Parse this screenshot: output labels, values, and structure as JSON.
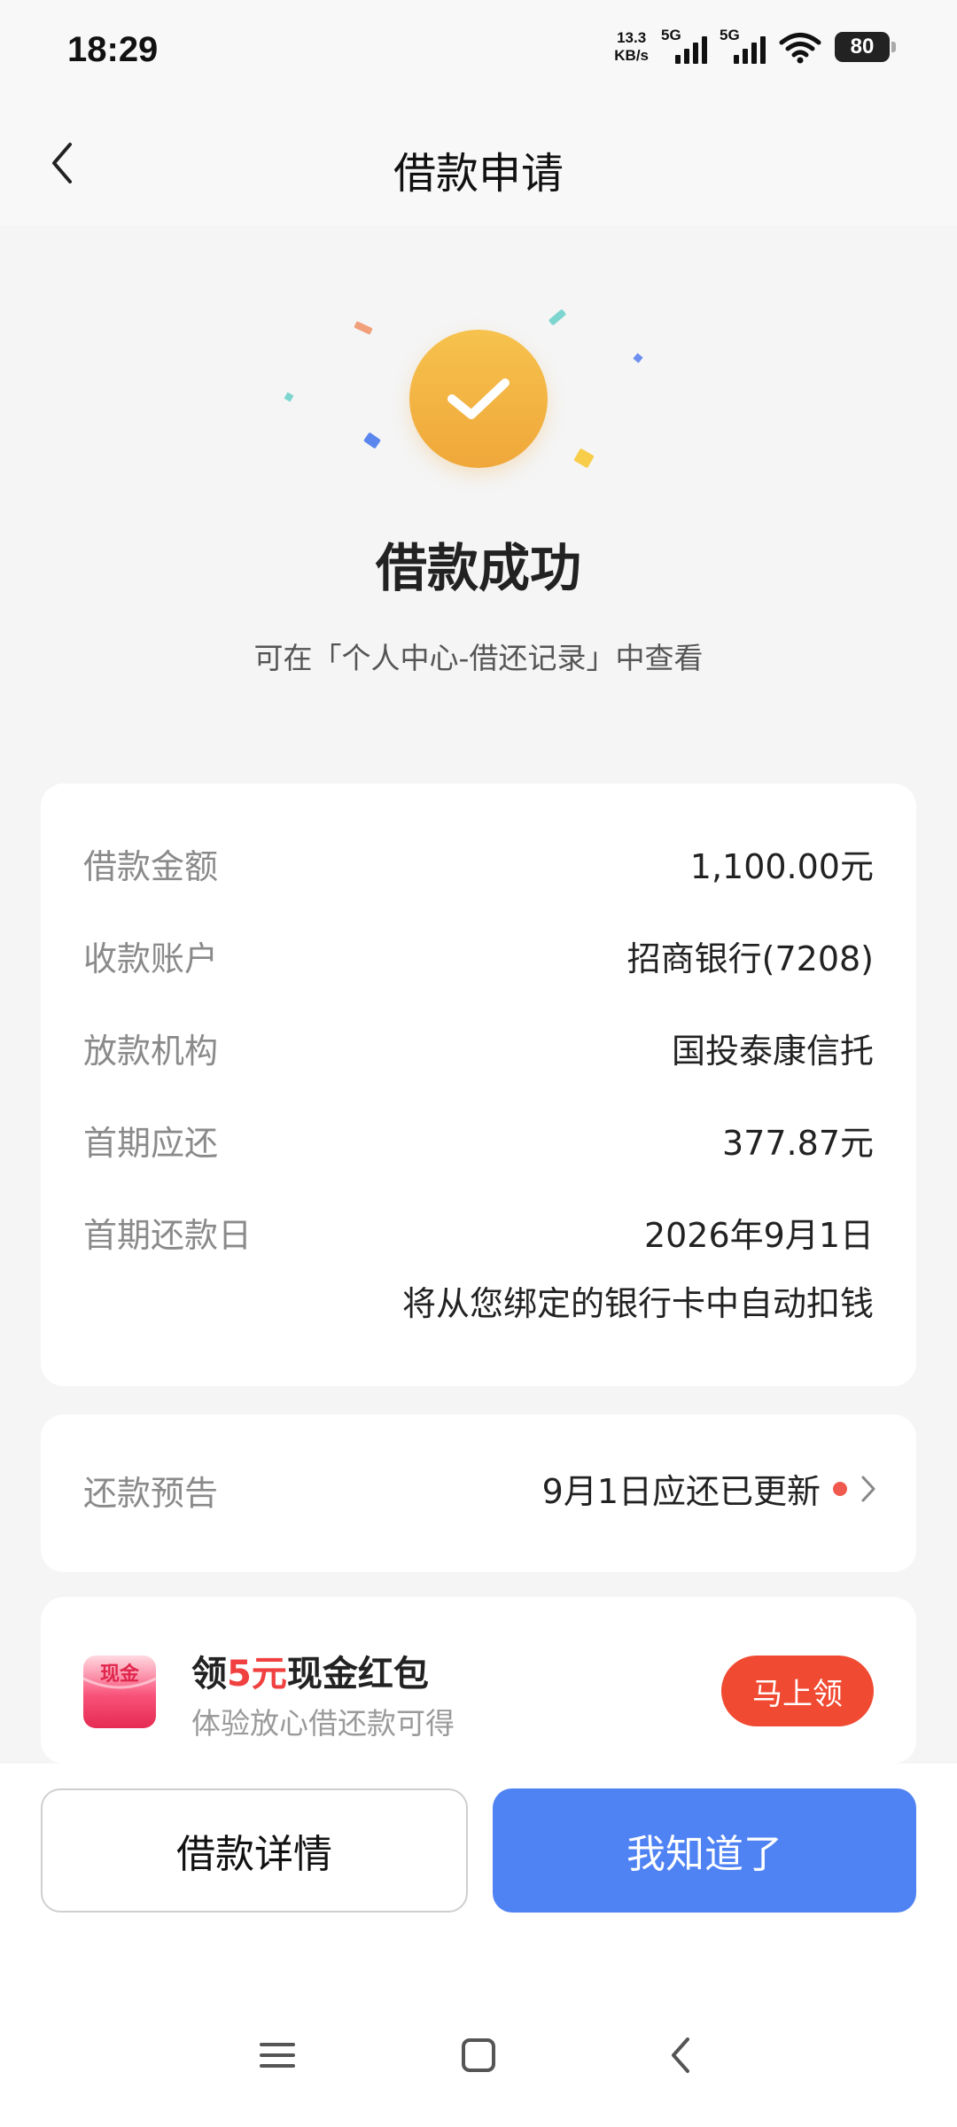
{
  "status_bar": {
    "time": "18:29",
    "net_speed_value": "13.3",
    "net_speed_unit": "KB/s",
    "signal_1_label": "5G",
    "signal_2_label": "5G",
    "battery": "80"
  },
  "header": {
    "title": "借款申请"
  },
  "hero": {
    "title": "借款成功",
    "subtitle": "可在「个人中心-借还记录」中查看"
  },
  "details": {
    "rows": [
      {
        "label": "借款金额",
        "value": "1,100.00元"
      },
      {
        "label": "收款账户",
        "value": "招商银行(7208)"
      },
      {
        "label": "放款机构",
        "value": "国投泰康信托"
      },
      {
        "label": "首期应还",
        "value": "377.87元"
      },
      {
        "label": "首期还款日",
        "value": "2026年9月1日"
      }
    ],
    "note": "将从您绑定的银行卡中自动扣钱"
  },
  "repayment_notice": {
    "label": "还款预告",
    "value": "9月1日应还已更新"
  },
  "promo": {
    "icon_text": "现金",
    "title_prefix": "领",
    "title_highlight": "5元",
    "title_suffix": "现金红包",
    "subtitle": "体验放心借还款可得",
    "button": "马上领"
  },
  "actions": {
    "detail_button": "借款详情",
    "ok_button": "我知道了"
  },
  "colors": {
    "primary_blue": "#4f82f3",
    "success_orange": "#f0a73a",
    "promo_red": "#f04a32",
    "highlight_red": "#f04040"
  }
}
